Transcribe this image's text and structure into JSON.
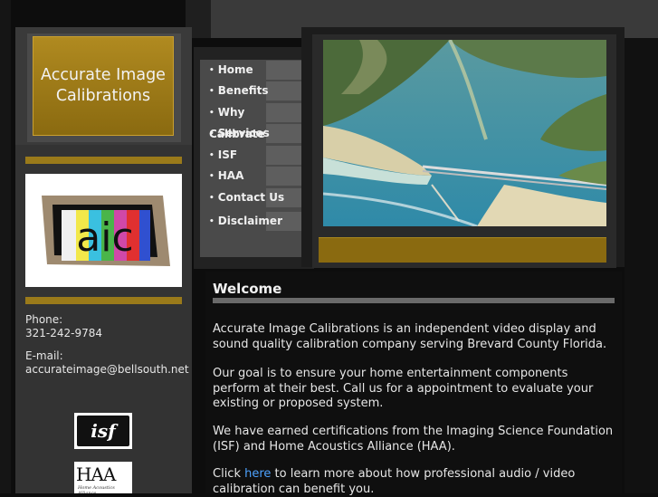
{
  "site": {
    "title": "Accurate Image\nCalibrations",
    "logo_text": "aic"
  },
  "nav": {
    "items": [
      {
        "label": "Home"
      },
      {
        "label": "Benefits"
      },
      {
        "label": "Why Calibrate?"
      },
      {
        "label": "Services"
      },
      {
        "label": "ISF"
      },
      {
        "label": "HAA"
      },
      {
        "label": "Contact Us"
      },
      {
        "label": "Disclaimer"
      }
    ]
  },
  "contact": {
    "phone_label": "Phone:",
    "phone": "321-242-9784",
    "email_label": "E-mail:",
    "email": "accurateimage@bellsouth.net"
  },
  "badges": {
    "isf": "isf",
    "haa": "HAA",
    "haa_sub": "Home Acoustics Alliance"
  },
  "main": {
    "heading": "Welcome",
    "p1": "Accurate Image Calibrations is an independent video display and sound quality calibration company serving Brevard County Florida.",
    "p2": "Our goal is to ensure your home entertainment components perform at their best.  Call us for a appointment to evaluate your existing or proposed system.",
    "p3": "We have earned certifications from the Imaging Science Foundation (ISF) and Home Acoustics Alliance (HAA).",
    "p4_pre": "Click ",
    "p4_link": "here",
    "p4_post": " to learn more about how professional audio / video calibration can benefit you."
  },
  "colors": {
    "gold": "#9a7a1a",
    "panel": "#3a3a3a",
    "link": "#4ea3ff"
  }
}
